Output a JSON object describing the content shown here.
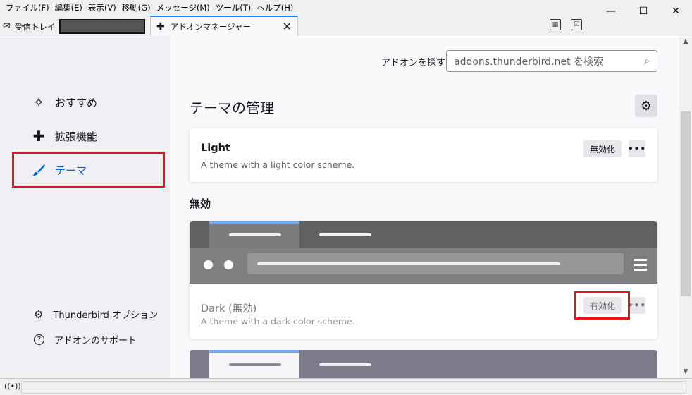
{
  "menubar": {
    "items": [
      "ファイル(F)",
      "編集(E)",
      "表示(V)",
      "移動(G)",
      "メッセージ(M)",
      "ツール(T)",
      "ヘルプ(H)"
    ]
  },
  "window_controls": {
    "minimize": "—",
    "maximize": "☐",
    "close": "✕"
  },
  "tabs": {
    "inbox_label": "受信トレイ",
    "addons_label": "アドオンマネージャー",
    "close_glyph": "✕"
  },
  "sidebar": {
    "items": [
      {
        "label": "おすすめ",
        "icon": "sparkle-icon"
      },
      {
        "label": "拡張機能",
        "icon": "puzzle-icon"
      },
      {
        "label": "テーマ",
        "icon": "brush-icon",
        "active": true
      }
    ],
    "footer": [
      {
        "label": "Thunderbird オプション",
        "icon": "gear-icon"
      },
      {
        "label": "アドオンのサポート",
        "icon": "help-icon"
      }
    ]
  },
  "main": {
    "search_label": "アドオンを探す",
    "search_placeholder": "addons.thunderbird.net を検索",
    "title": "テーマの管理",
    "enabled_theme": {
      "name": "Light",
      "description": "A theme with a light color scheme.",
      "button": "無効化",
      "more": "•••"
    },
    "disabled_heading": "無効",
    "disabled_theme": {
      "name": "Dark (無効)",
      "description": "A theme with a dark color scheme.",
      "button": "有効化",
      "more": "•••"
    }
  },
  "colors": {
    "accent": "#0061e0",
    "highlight_red": "#e0161d"
  }
}
